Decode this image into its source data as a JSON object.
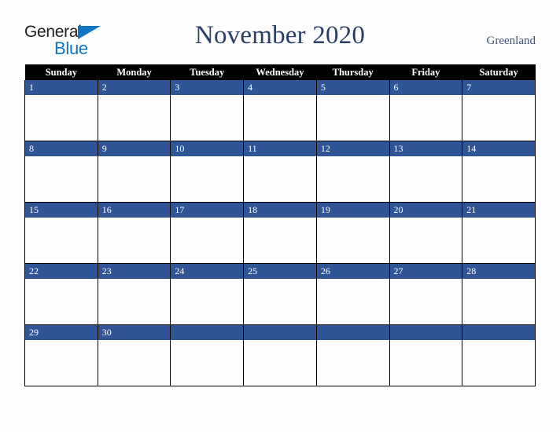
{
  "brand": {
    "name_part1": "General",
    "name_part2": "Blue",
    "triangle_icon": "triangle-icon",
    "color_dark": "#231f20",
    "color_blue": "#0f76c1"
  },
  "header": {
    "title": "November 2020",
    "region": "Greenland",
    "title_color": "#2b3e63"
  },
  "calendar": {
    "accent_color": "#2f5597",
    "header_bg": "#000000",
    "weekday_headers": [
      "Sunday",
      "Monday",
      "Tuesday",
      "Wednesday",
      "Thursday",
      "Friday",
      "Saturday"
    ],
    "weeks": [
      [
        "1",
        "2",
        "3",
        "4",
        "5",
        "6",
        "7"
      ],
      [
        "8",
        "9",
        "10",
        "11",
        "12",
        "13",
        "14"
      ],
      [
        "15",
        "16",
        "17",
        "18",
        "19",
        "20",
        "21"
      ],
      [
        "22",
        "23",
        "24",
        "25",
        "26",
        "27",
        "28"
      ],
      [
        "29",
        "30",
        "",
        "",
        "",
        "",
        ""
      ]
    ]
  }
}
